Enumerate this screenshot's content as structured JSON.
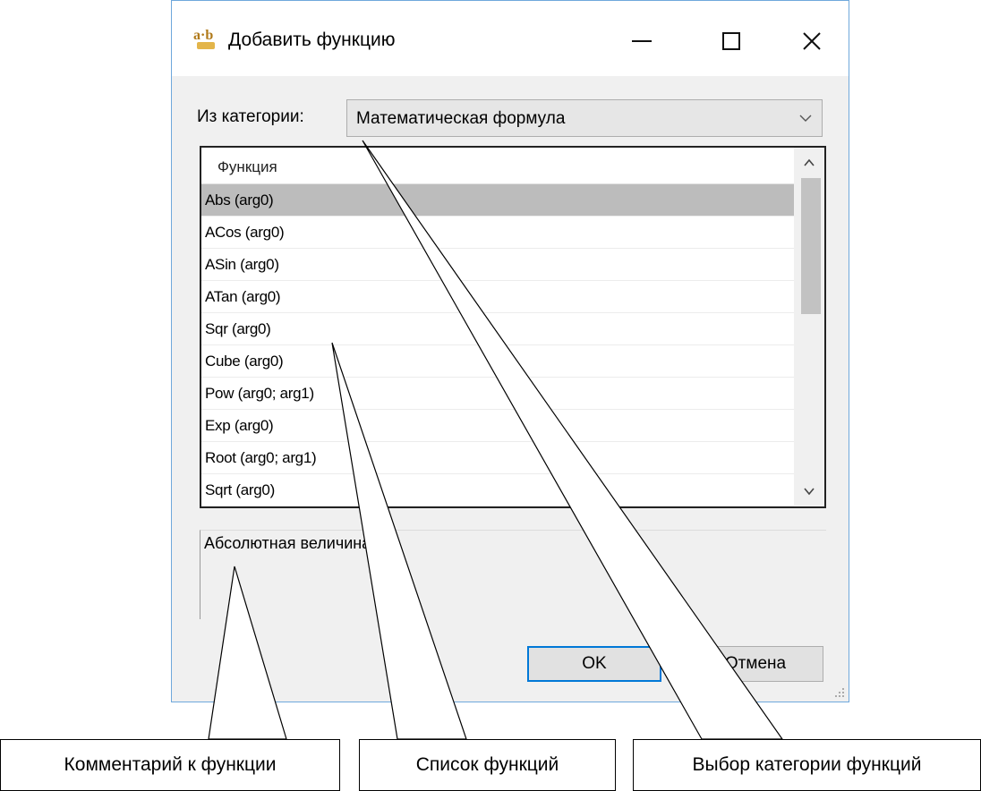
{
  "window": {
    "title": "Добавить функцию",
    "icon": "ab-function-icon",
    "controls": [
      "minimize-icon",
      "maximize-icon",
      "close-icon"
    ]
  },
  "category": {
    "label": "Из категории:",
    "selected": "Математическая формула"
  },
  "function_list": {
    "header": "Функция",
    "items": [
      "Abs (arg0)",
      "ACos (arg0)",
      "ASin (arg0)",
      "ATan (arg0)",
      "Sqr (arg0)",
      "Cube (arg0)",
      "Pow (arg0; arg1)",
      "Exp (arg0)",
      "Root (arg0; arg1)",
      "Sqrt (arg0)"
    ],
    "selected_index": 0
  },
  "comment": "Абсолютная величина",
  "buttons": {
    "ok": "OK",
    "cancel": "Отмена"
  },
  "callouts": {
    "comment": "Комментарий к функции",
    "list": "Список функций",
    "category": "Выбор категории функций"
  }
}
